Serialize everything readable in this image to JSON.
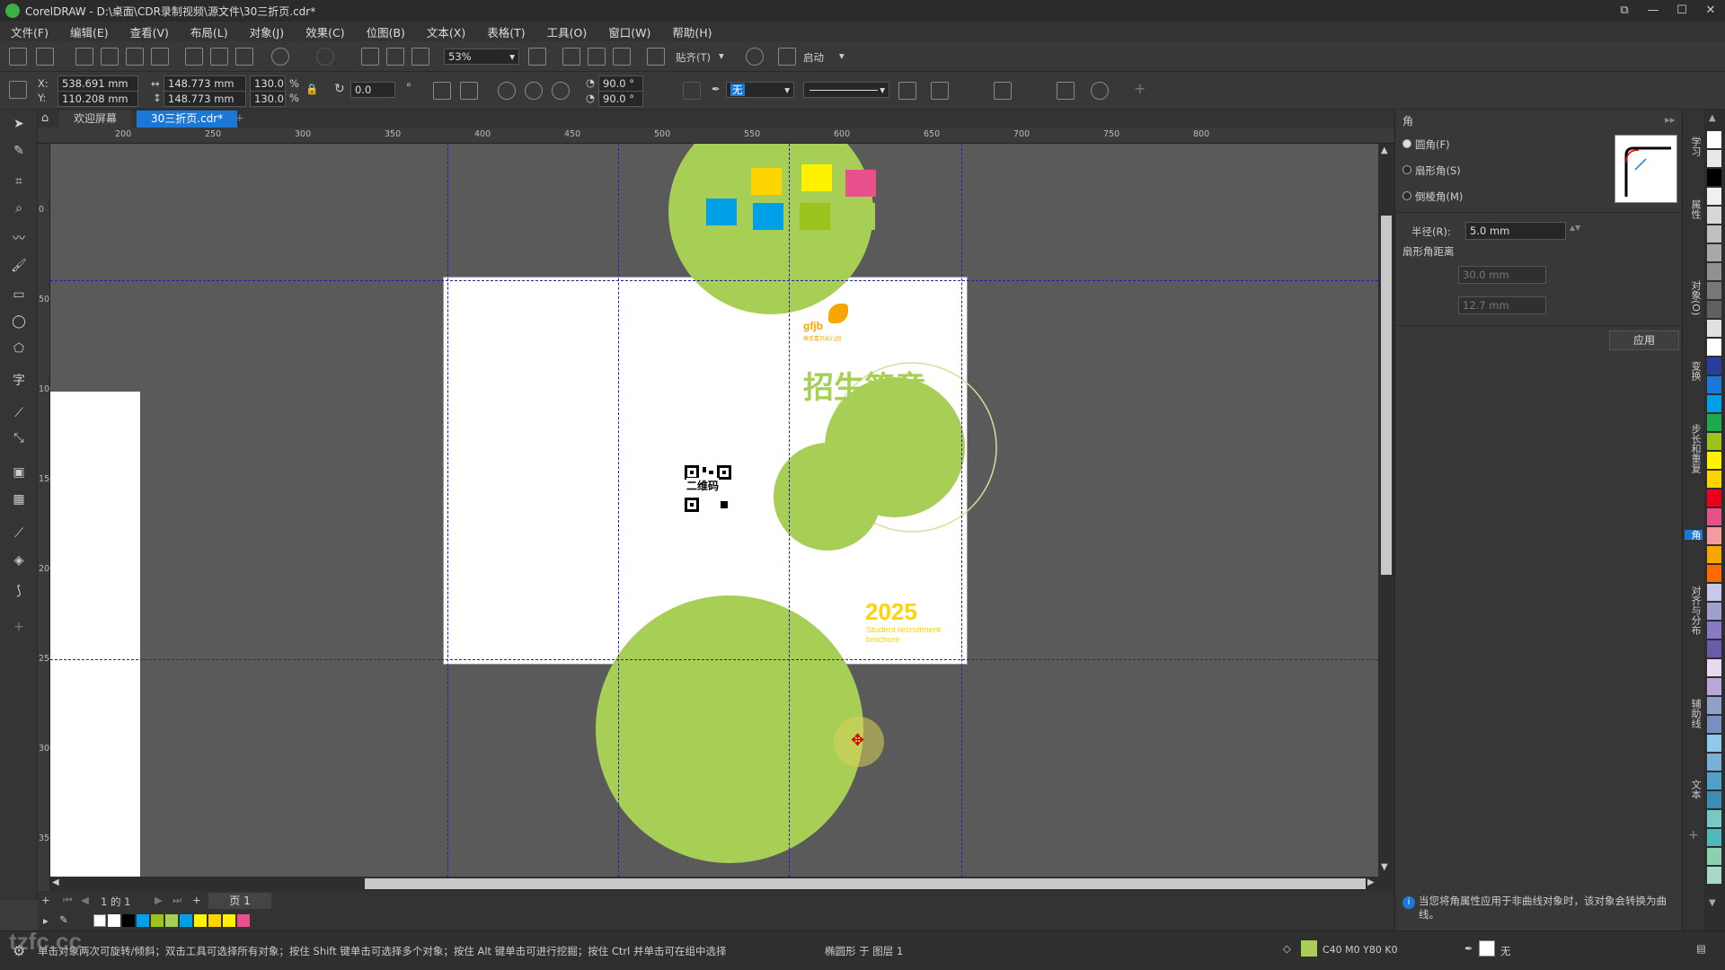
{
  "titlebar": {
    "title": "CorelDRAW - D:\\桌面\\CDR录制视频\\源文件\\30三折页.cdr*"
  },
  "menu": [
    "文件(F)",
    "编辑(E)",
    "查看(V)",
    "布局(L)",
    "对象(J)",
    "效果(C)",
    "位图(B)",
    "文本(X)",
    "表格(T)",
    "工具(O)",
    "窗口(W)",
    "帮助(H)"
  ],
  "toolbar1": {
    "zoom": "53%",
    "snap_label": "贴齐(T)",
    "launch_label": "启动"
  },
  "propbar": {
    "x_label": "X:",
    "x_value": "538.691 mm",
    "y_label": "Y:",
    "y_value": "110.208 mm",
    "w_value": "148.773 mm",
    "h_value": "148.773 mm",
    "scale_w": "130.0",
    "scale_h": "130.0",
    "pct": "%",
    "rotation": "0.0",
    "angle1": "90.0 °",
    "angle2": "90.0 °",
    "outline_none": "无"
  },
  "doctabs": {
    "welcome": "欢迎屏幕",
    "file": "30三折页.cdr*"
  },
  "ruler_h": [
    "200",
    "250",
    "300",
    "350",
    "400",
    "450",
    "500",
    "550",
    "600",
    "650",
    "700",
    "750",
    "800"
  ],
  "ruler_v": [
    "0",
    "50",
    "100",
    "150",
    "200",
    "250",
    "300",
    "350"
  ],
  "artwork": {
    "logo_text": "gfjb",
    "logo_sub": "格菲嘉贝幼儿园",
    "title": "招生简章",
    "qr_text": "二维码",
    "year": "2025",
    "subtitle_line1": "Student recruitment",
    "subtitle_line2": "brochure"
  },
  "colors": {
    "green": "#a8cf55",
    "yellow": "#ffd500",
    "lightyellow": "#fff200",
    "blue": "#00a0e9",
    "pink": "#e8508c",
    "olive": "#9bc31c",
    "select_blue": "#1c78d6"
  },
  "pagebar": {
    "page_count": "1 的 1",
    "page_tab": "页 1"
  },
  "docker": {
    "title": "角",
    "option_round": "圆角(F)",
    "option_scallop": "扇形角(S)",
    "option_chamfer": "倒棱角(M)",
    "radius_label": "半径(R):",
    "radius_value": "5.0 mm",
    "scallop_distance_label": "扇形角距离",
    "distance1": "30.0 mm",
    "distance2": "12.7 mm",
    "apply_button": "应用",
    "info_text": "当您将角属性应用于非曲线对象时，该对象会转换为曲线。"
  },
  "docker_tabs": [
    "学习",
    "属性",
    "对象(O)",
    "变换",
    "步长和重复",
    "角",
    "对齐与分布",
    "辅助线",
    "文本"
  ],
  "statusbar": {
    "hint": "单击对象两次可旋转/倾斜；双击工具可选择所有对象；按住 Shift 键单击可选择多个对象；按住 Alt 键单击可进行挖掘；按住 Ctrl 并单击可在组中选择",
    "object_info": "椭圆形 于 图层 1",
    "fill_info": "C40 M0 Y80 K0",
    "outline_info": "无"
  },
  "watermark": "tzfc.cc"
}
